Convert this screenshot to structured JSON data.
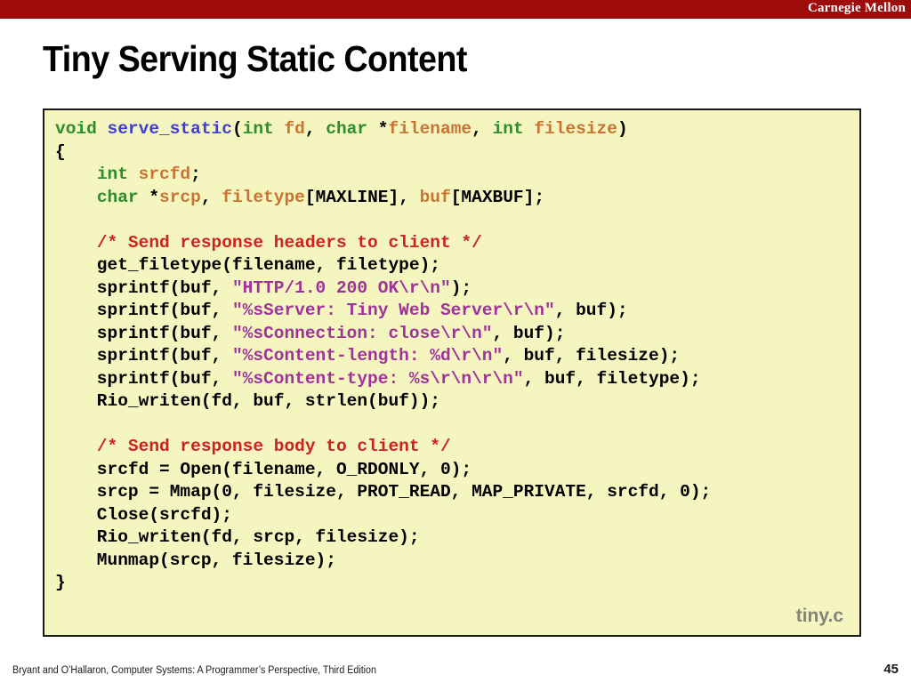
{
  "banner": {
    "brand": "Carnegie Mellon",
    "color": "#9e0b0b"
  },
  "slide": {
    "title": "Tiny Serving Static Content",
    "file_label": "tiny.c"
  },
  "colors": {
    "code_background": "#f5f5c0",
    "code_border": "#1a1a1a",
    "type_keyword": "#2e8b2e",
    "function_name": "#4040cc",
    "variable": "#c87533",
    "comment": "#cc2222",
    "string": "#a0329b",
    "plain": "#000000",
    "file_label": "#838377"
  },
  "code": {
    "language": "c",
    "lines": [
      [
        {
          "t": "void ",
          "c": "type"
        },
        {
          "t": "serve_static",
          "c": "fname"
        },
        {
          "t": "(",
          "c": "plain"
        },
        {
          "t": "int ",
          "c": "type"
        },
        {
          "t": "fd",
          "c": "var"
        },
        {
          "t": ", ",
          "c": "plain"
        },
        {
          "t": "char ",
          "c": "type"
        },
        {
          "t": "*",
          "c": "plain"
        },
        {
          "t": "filename",
          "c": "var"
        },
        {
          "t": ", ",
          "c": "plain"
        },
        {
          "t": "int ",
          "c": "type"
        },
        {
          "t": "filesize",
          "c": "var"
        },
        {
          "t": ")",
          "c": "plain"
        }
      ],
      [
        {
          "t": "{",
          "c": "plain"
        }
      ],
      [
        {
          "t": "    ",
          "c": "plain"
        },
        {
          "t": "int ",
          "c": "type"
        },
        {
          "t": "srcfd",
          "c": "var"
        },
        {
          "t": ";",
          "c": "plain"
        }
      ],
      [
        {
          "t": "    ",
          "c": "plain"
        },
        {
          "t": "char ",
          "c": "type"
        },
        {
          "t": "*",
          "c": "plain"
        },
        {
          "t": "srcp",
          "c": "var"
        },
        {
          "t": ", ",
          "c": "plain"
        },
        {
          "t": "filetype",
          "c": "var"
        },
        {
          "t": "[MAXLINE], ",
          "c": "plain"
        },
        {
          "t": "buf",
          "c": "var"
        },
        {
          "t": "[MAXBUF];",
          "c": "plain"
        }
      ],
      [
        {
          "t": "",
          "c": "plain"
        }
      ],
      [
        {
          "t": "    ",
          "c": "plain"
        },
        {
          "t": "/* Send response headers to client */",
          "c": "comment"
        }
      ],
      [
        {
          "t": "    get_filetype(filename, filetype);",
          "c": "plain"
        }
      ],
      [
        {
          "t": "    sprintf(buf, ",
          "c": "plain"
        },
        {
          "t": "\"HTTP/1.0 200 OK\\r\\n\"",
          "c": "string"
        },
        {
          "t": ");",
          "c": "plain"
        }
      ],
      [
        {
          "t": "    sprintf(buf, ",
          "c": "plain"
        },
        {
          "t": "\"%sServer: Tiny Web Server\\r\\n\"",
          "c": "string"
        },
        {
          "t": ", buf);",
          "c": "plain"
        }
      ],
      [
        {
          "t": "    sprintf(buf, ",
          "c": "plain"
        },
        {
          "t": "\"%sConnection: close\\r\\n\"",
          "c": "string"
        },
        {
          "t": ", buf);",
          "c": "plain"
        }
      ],
      [
        {
          "t": "    sprintf(buf, ",
          "c": "plain"
        },
        {
          "t": "\"%sContent-length: %d\\r\\n\"",
          "c": "string"
        },
        {
          "t": ", buf, filesize);",
          "c": "plain"
        }
      ],
      [
        {
          "t": "    sprintf(buf, ",
          "c": "plain"
        },
        {
          "t": "\"%sContent-type: %s\\r\\n\\r\\n\"",
          "c": "string"
        },
        {
          "t": ", buf, filetype);",
          "c": "plain"
        }
      ],
      [
        {
          "t": "    Rio_writen(fd, buf, strlen(buf));",
          "c": "plain"
        }
      ],
      [
        {
          "t": "",
          "c": "plain"
        }
      ],
      [
        {
          "t": "    ",
          "c": "plain"
        },
        {
          "t": "/* Send response body to client */",
          "c": "comment"
        }
      ],
      [
        {
          "t": "    srcfd = Open(filename, O_RDONLY, 0);",
          "c": "plain"
        }
      ],
      [
        {
          "t": "    srcp = Mmap(0, filesize, PROT_READ, MAP_PRIVATE, srcfd, 0);",
          "c": "plain"
        }
      ],
      [
        {
          "t": "    Close(srcfd);",
          "c": "plain"
        }
      ],
      [
        {
          "t": "    Rio_writen(fd, srcp, filesize);",
          "c": "plain"
        }
      ],
      [
        {
          "t": "    Munmap(srcp, filesize);",
          "c": "plain"
        }
      ],
      [
        {
          "t": "}",
          "c": "plain"
        }
      ]
    ]
  },
  "footer": {
    "attribution": "Bryant and O’Hallaron, Computer Systems: A Programmer’s Perspective, Third Edition",
    "page_number": "45"
  }
}
